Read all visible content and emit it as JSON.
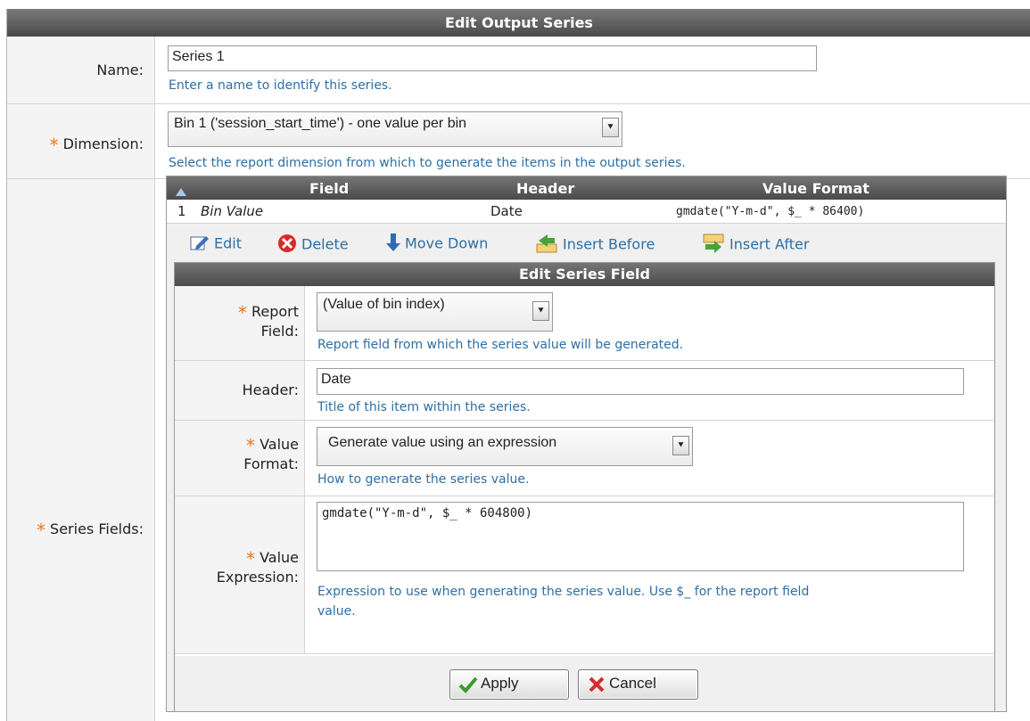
{
  "form": {
    "title": "Edit Output Series",
    "name": {
      "label": "Name:",
      "value": "Series 1",
      "help": "Enter a name to identify this series."
    },
    "dimension": {
      "label": "Dimension:",
      "value": "Bin 1 ('session_start_time') - one value per bin",
      "help": "Select the report dimension from which to generate the items in the output series."
    },
    "series_fields_label": "Series Fields:"
  },
  "grid": {
    "columns": [
      "Field",
      "Header",
      "Value Format"
    ],
    "rows": [
      {
        "index": "1",
        "field": "Bin Value",
        "header": "Date",
        "value_format": "gmdate(\"Y-m-d\", $_ * 86400)"
      }
    ],
    "actions": {
      "edit": "Edit",
      "delete": "Delete",
      "move_down": "Move Down",
      "insert_before": "Insert Before",
      "insert_after": "Insert After"
    }
  },
  "edit_field": {
    "title": "Edit Series Field",
    "report_field": {
      "label_line1": "Report",
      "label_line2": "Field:",
      "value": "(Value of bin index)",
      "help": "Report field from which the series value will be generated."
    },
    "header": {
      "label": "Header:",
      "value": "Date",
      "help": "Title of this item within the series."
    },
    "value_format": {
      "label_line1": "Value",
      "label_line2": "Format:",
      "value": "Generate value using an expression",
      "help": "How to generate the series value."
    },
    "value_expression": {
      "label_line1": "Value",
      "label_line2": "Expression:",
      "value": "gmdate(\"Y-m-d\", $_ * 604800)",
      "help_line1": "Expression to use when generating the series value. Use $_ for the report field",
      "help_line2": "value."
    },
    "apply": "Apply",
    "cancel": "Cancel"
  },
  "colors": {
    "required_star": "#e8771e",
    "help_text": "#2d6fa6",
    "header_bg": "#555555"
  }
}
